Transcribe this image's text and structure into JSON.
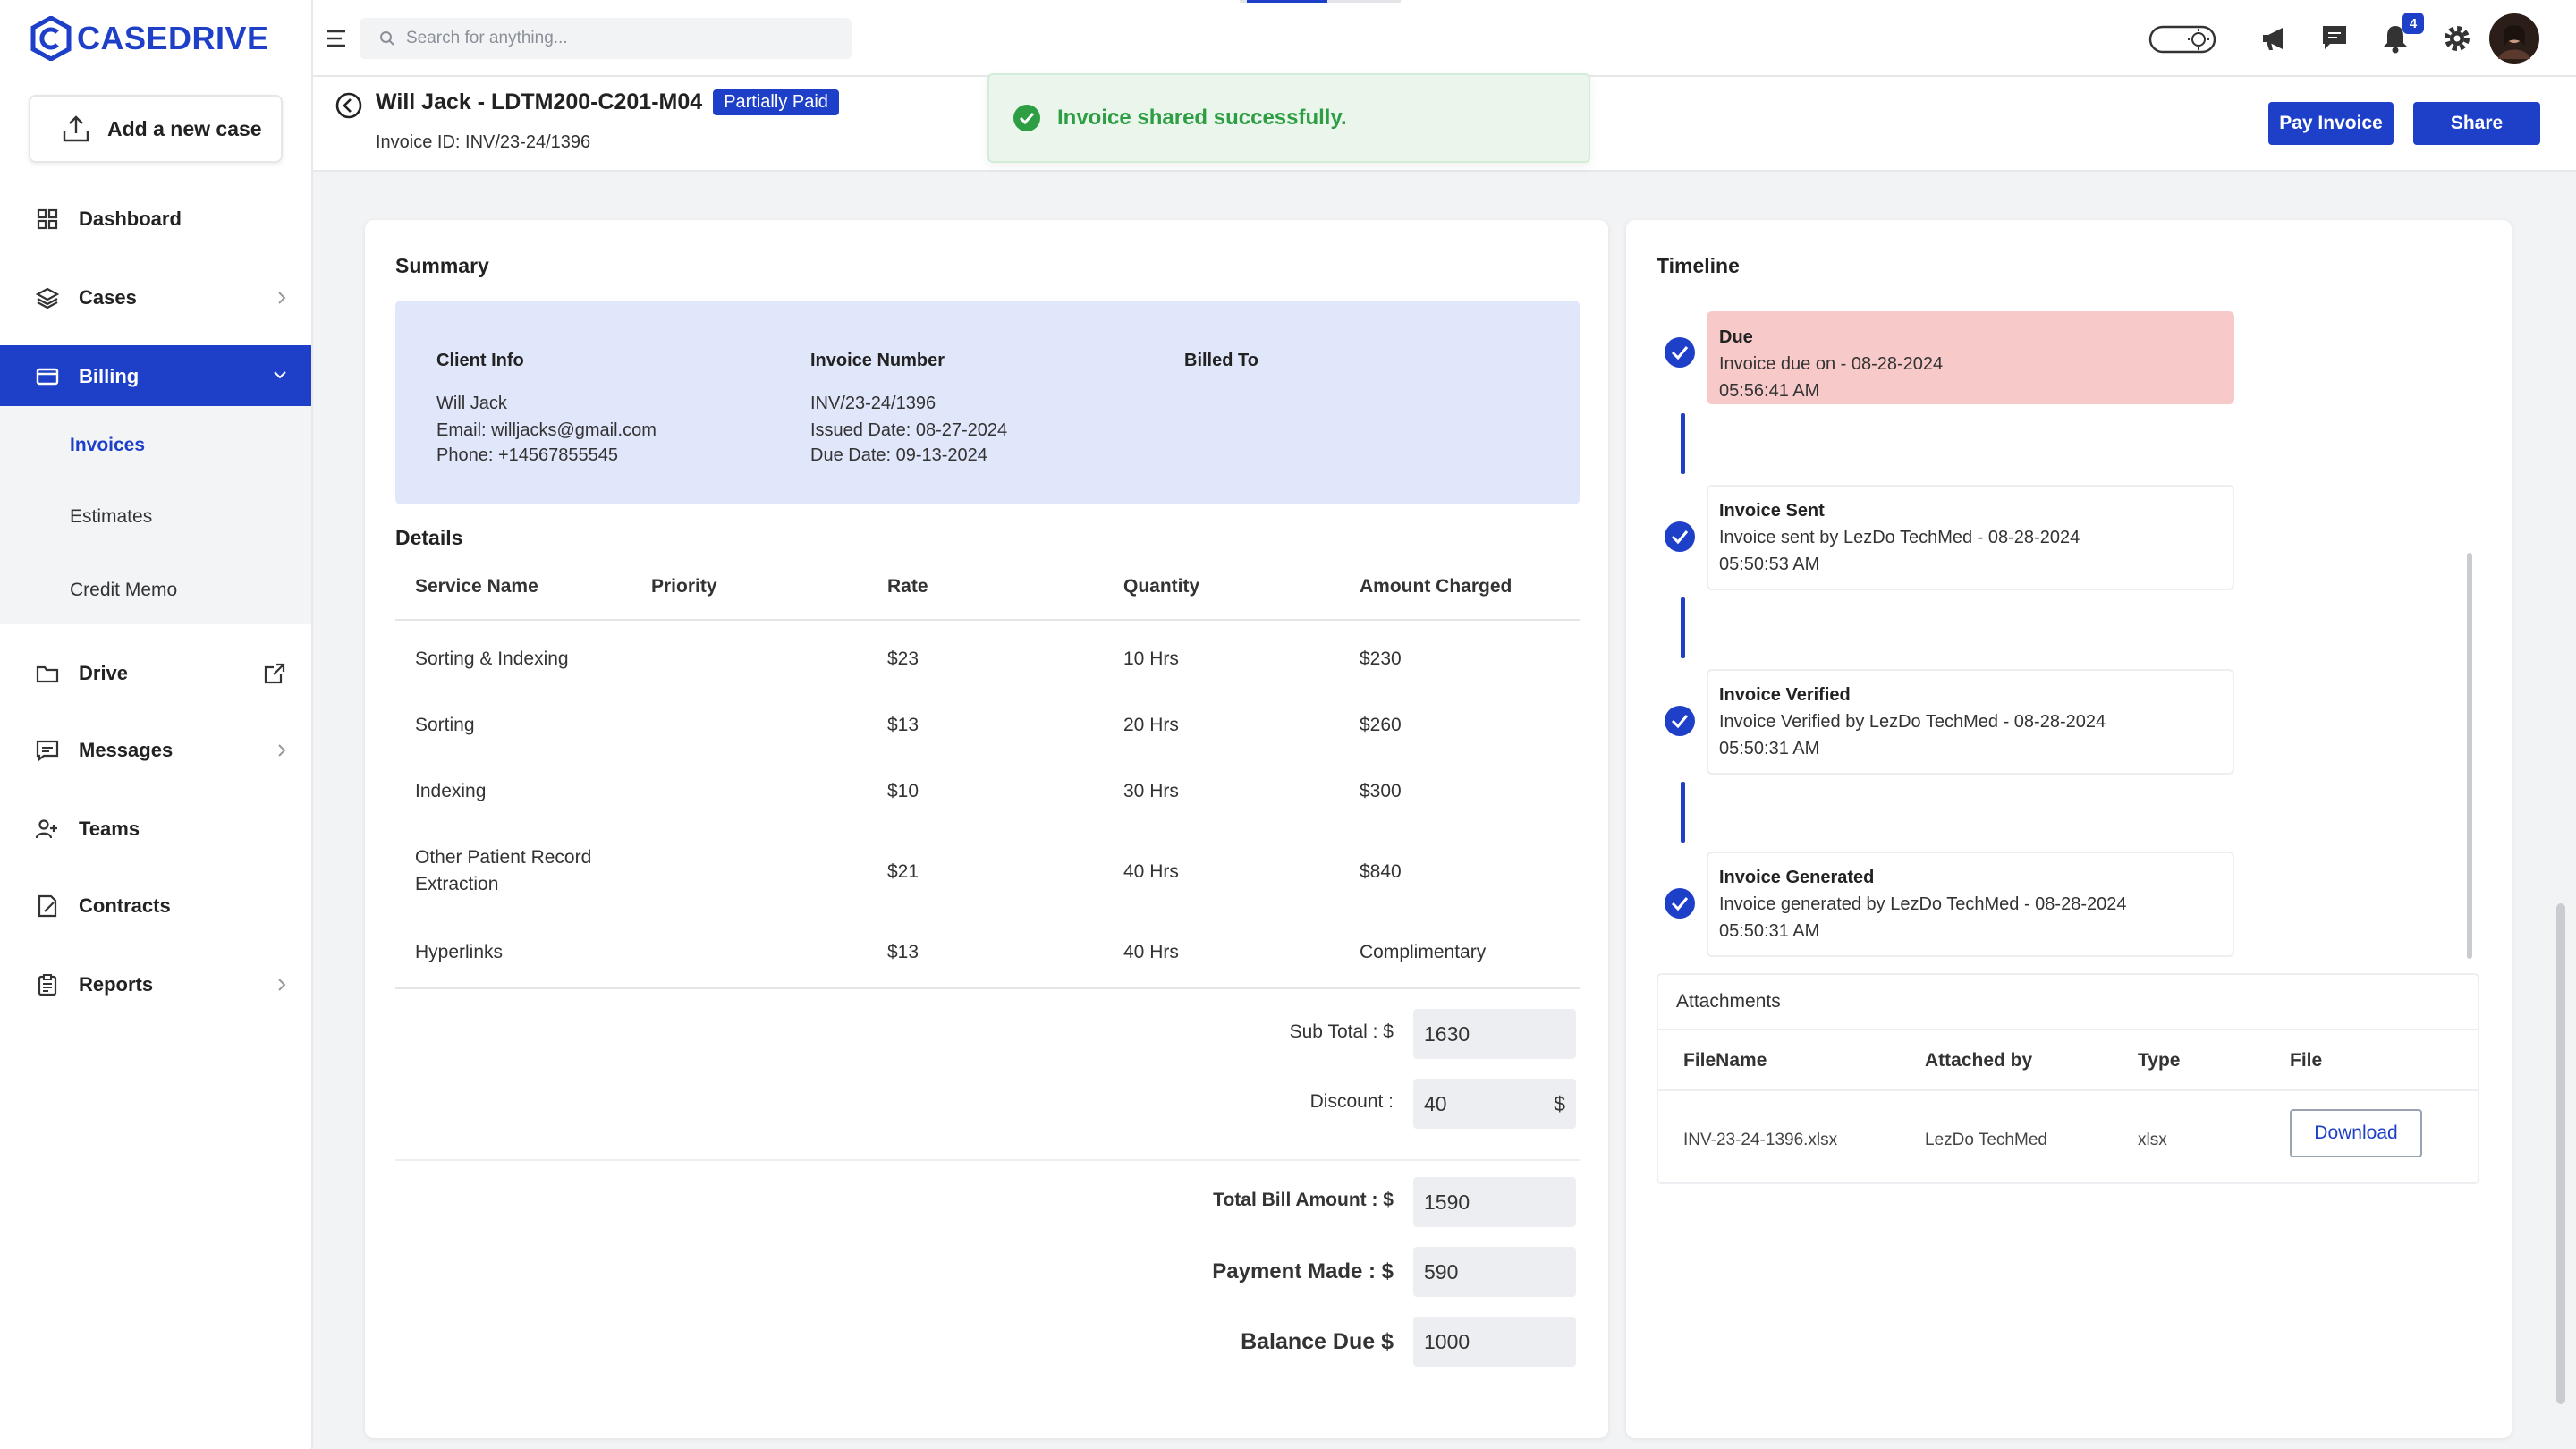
{
  "app": {
    "logo": "CASEDRIVE"
  },
  "sidebar": {
    "add_case": "Add a new case",
    "items": [
      {
        "label": "Dashboard",
        "icon": "dashboard-icon"
      },
      {
        "label": "Cases",
        "icon": "layers-icon"
      },
      {
        "label": "Billing",
        "icon": "billing-icon"
      },
      {
        "label": "Drive",
        "icon": "folder-icon"
      },
      {
        "label": "Messages",
        "icon": "messages-icon"
      },
      {
        "label": "Teams",
        "icon": "teams-icon"
      },
      {
        "label": "Contracts",
        "icon": "contracts-icon"
      },
      {
        "label": "Reports",
        "icon": "reports-icon"
      }
    ],
    "billing_sub": [
      "Invoices",
      "Estimates",
      "Credit Memo"
    ]
  },
  "topbar": {
    "search_placeholder": "Search for anything...",
    "notification_count": "4"
  },
  "header": {
    "title": "Will Jack - LDTM200-C201-M04",
    "status": "Partially Paid",
    "invoice_id": "Invoice ID: INV/23-24/1396",
    "pay_button": "Pay Invoice",
    "share_button": "Share"
  },
  "toast": {
    "message": "Invoice shared successfully."
  },
  "summary": {
    "title": "Summary",
    "client_info": {
      "heading": "Client Info",
      "lines": [
        "Will Jack",
        "Email: willjacks@gmail.com",
        "Phone: +14567855545"
      ]
    },
    "invoice_number": {
      "heading": "Invoice Number",
      "lines": [
        "INV/23-24/1396",
        "Issued Date: 08-27-2024",
        "Due Date: 09-13-2024"
      ]
    },
    "billed_to": {
      "heading": "Billed To"
    }
  },
  "details": {
    "title": "Details",
    "columns": [
      "Service Name",
      "Priority",
      "Rate",
      "Quantity",
      "Amount Charged"
    ],
    "rows": [
      {
        "service": "Sorting & Indexing",
        "priority": "",
        "rate": "$23",
        "quantity": "10 Hrs",
        "amount": "$230"
      },
      {
        "service": "Sorting",
        "priority": "",
        "rate": "$13",
        "quantity": "20 Hrs",
        "amount": "$260"
      },
      {
        "service": "Indexing",
        "priority": "",
        "rate": "$10",
        "quantity": "30 Hrs",
        "amount": "$300"
      },
      {
        "service": "Other Patient Record",
        "service2": "Extraction",
        "priority": "",
        "rate": "$21",
        "quantity": "40 Hrs",
        "amount": "$840"
      },
      {
        "service": "Hyperlinks",
        "priority": "",
        "rate": "$13",
        "quantity": "40 Hrs",
        "amount": "Complimentary"
      }
    ]
  },
  "totals": {
    "subtotal_label": "Sub Total : $",
    "subtotal": "1630",
    "discount_label": "Discount :",
    "discount": "40",
    "discount_unit": "$",
    "total_label": "Total Bill Amount : $",
    "total": "1590",
    "paid_label": "Payment Made : $",
    "paid": "590",
    "balance_label": "Balance Due $",
    "balance": "1000"
  },
  "timeline": {
    "title": "Timeline",
    "items": [
      {
        "title": "Due",
        "line1": "Invoice due on - 08-28-2024",
        "line2": "05:56:41 AM"
      },
      {
        "title": "Invoice Sent",
        "line1": "Invoice sent by LezDo TechMed - 08-28-2024",
        "line2": "05:50:53 AM"
      },
      {
        "title": "Invoice Verified",
        "line1": "Invoice Verified by LezDo TechMed - 08-28-2024",
        "line2": "05:50:31 AM"
      },
      {
        "title": "Invoice Generated",
        "line1": "Invoice generated by LezDo TechMed - 08-28-2024",
        "line2": "05:50:31 AM"
      }
    ]
  },
  "attachments": {
    "title": "Attachments",
    "columns": [
      "FileName",
      "Attached by",
      "Type",
      "File"
    ],
    "row": {
      "filename": "INV-23-24-1396.xlsx",
      "attached_by": "LezDo TechMed",
      "type": "xlsx",
      "action": "Download"
    }
  },
  "colors": {
    "brand": "#1e40c8",
    "success": "#2e9e44",
    "due_bg": "#f8c9c9",
    "summary_bg": "#e1e7fb"
  }
}
